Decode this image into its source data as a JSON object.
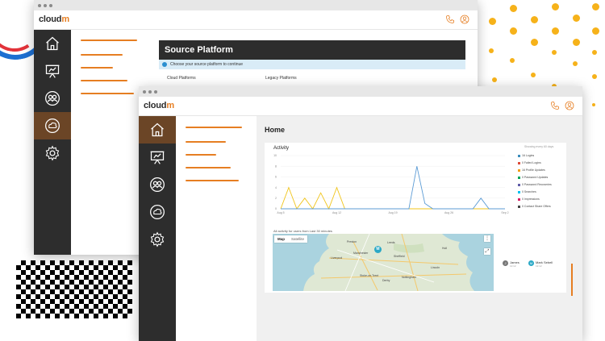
{
  "brand": {
    "logo_prefix": "cloud",
    "logo_suffix": "m",
    "accent": "#e67e22",
    "sidebar_color": "#2d2d2d",
    "active_nav_color": "#6b4526"
  },
  "nav_icons": [
    "home-icon",
    "presentation-icon",
    "users-icon",
    "cloud-sync-icon",
    "settings-icon"
  ],
  "header_icons": [
    "phone-icon",
    "user-icon"
  ],
  "back_window": {
    "panel_title": "Source Platform",
    "info_text": "Choose your source platform to continue",
    "columns": [
      "Cloud Platforms",
      "Legacy Platforms"
    ]
  },
  "front_window": {
    "page_title": "Home",
    "activity": {
      "title": "Activity",
      "legend_title": "Showing every 60 days",
      "legend": [
        {
          "label": "16 Logins",
          "color": "#3c8dbc"
        },
        {
          "label": "0 Failed Logins",
          "color": "#dd4b39"
        },
        {
          "label": "16 Profile Updates",
          "color": "#f39c12"
        },
        {
          "label": "0 Password Updates",
          "color": "#00a65a"
        },
        {
          "label": "0 Password Recoveries",
          "color": "#605ca8"
        },
        {
          "label": "0 Searches",
          "color": "#00c0ef"
        },
        {
          "label": "0 Impressions",
          "color": "#d81b60"
        },
        {
          "label": "0 Contact Share Offers",
          "color": "#444444"
        }
      ]
    },
    "map": {
      "label": "All activity for users from Last 30 minutes",
      "tab_map": "Map",
      "tab_satellite": "Satellite",
      "marker_text": "M",
      "cities": [
        "Preston",
        "Leeds",
        "Sheffield",
        "Manchester",
        "Liverpool",
        "Hull",
        "Lincoln",
        "Nottingham",
        "Derby",
        "Stoke-on-Trent"
      ]
    },
    "users": [
      {
        "initial": "J",
        "name": "James",
        "time": "12:12",
        "color": "#777777"
      },
      {
        "initial": "M",
        "name": "Mark Sebell",
        "time": "12:12",
        "color": "#2aa8c6"
      }
    ]
  },
  "chart_data": {
    "type": "line",
    "title": "Activity",
    "x_ticks": [
      "Aug 5",
      "Aug 12",
      "Aug 19",
      "Aug 26",
      "Sep 2"
    ],
    "ylim": [
      0,
      10
    ],
    "y_ticks": [
      0,
      2,
      4,
      6,
      8,
      10
    ],
    "series": [
      {
        "name": "16 Profile Updates",
        "color": "#f0c419",
        "x": [
          0,
          1,
          2,
          3,
          4,
          5,
          6,
          7,
          8,
          9,
          10,
          11,
          12,
          13,
          14,
          15,
          16,
          17,
          18,
          19,
          20,
          21,
          22,
          23,
          24,
          25,
          26,
          27,
          28
        ],
        "values": [
          0,
          4,
          0,
          2,
          0,
          3,
          0,
          4,
          0,
          0,
          0,
          0,
          0,
          0,
          0,
          0,
          0,
          0,
          0,
          0,
          0,
          0,
          0,
          0,
          0,
          0,
          0,
          0,
          0
        ]
      },
      {
        "name": "16 Logins",
        "color": "#5b9bd5",
        "x": [
          0,
          1,
          2,
          3,
          4,
          5,
          6,
          7,
          8,
          9,
          10,
          11,
          12,
          13,
          14,
          15,
          16,
          17,
          18,
          19,
          20,
          21,
          22,
          23,
          24,
          25,
          26,
          27,
          28
        ],
        "values": [
          0,
          0,
          0,
          0,
          0,
          0,
          0,
          0,
          0,
          0,
          0,
          0,
          0,
          0,
          0,
          0,
          0,
          8,
          1,
          0,
          0,
          0,
          0,
          0,
          0,
          2,
          0,
          0,
          0
        ]
      }
    ]
  }
}
